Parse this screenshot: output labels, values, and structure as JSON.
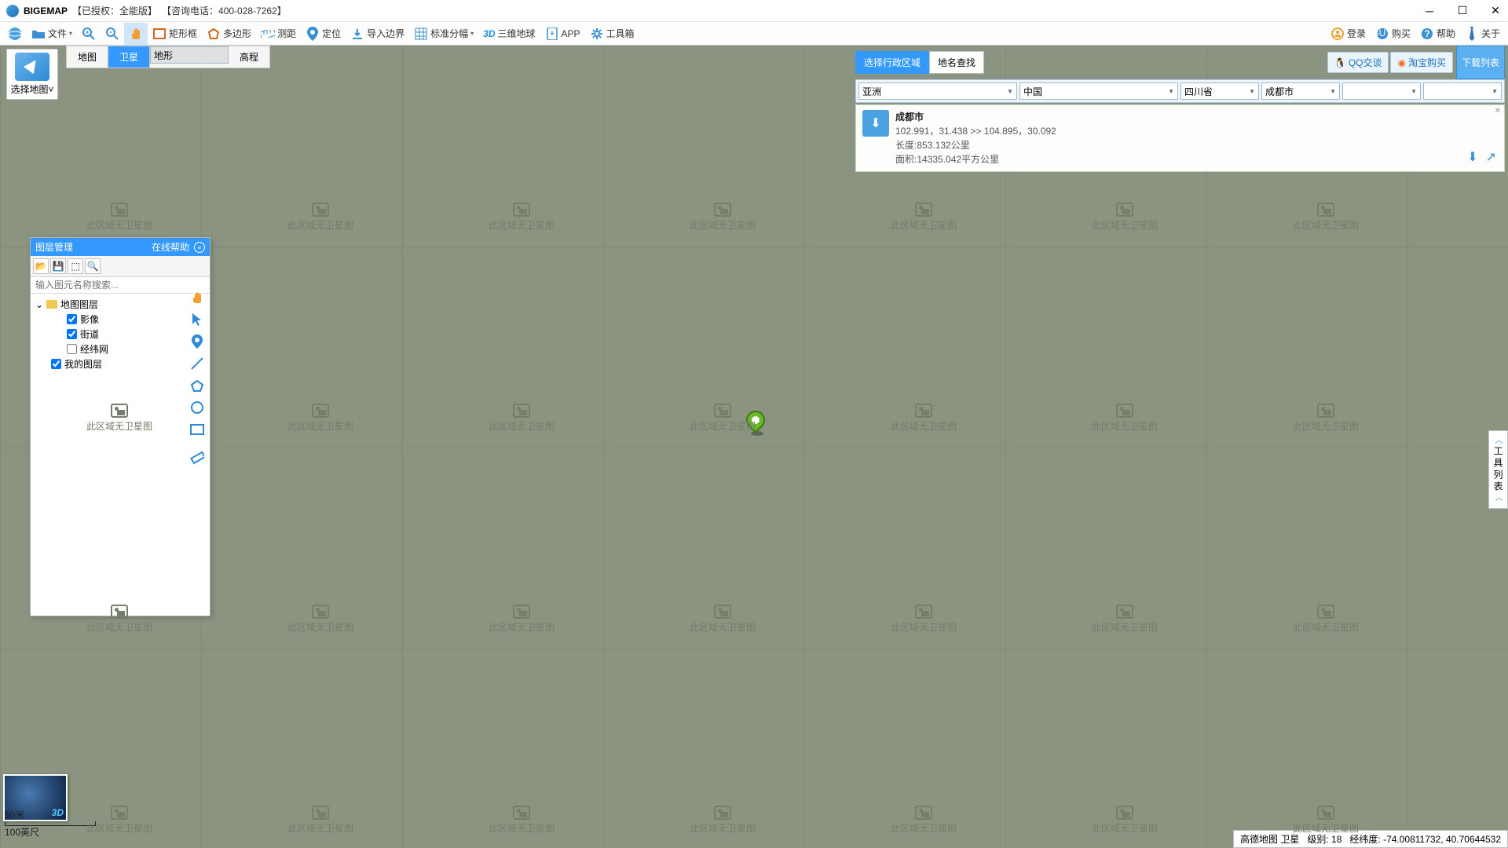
{
  "titlebar": {
    "app": "BIGEMAP",
    "auth": "【已授权：全能版】",
    "phone": "【咨询电话：400-028-7262】"
  },
  "toolbar": {
    "file": "文件",
    "rect": "矩形框",
    "poly": "多边形",
    "measure": "测距",
    "locate": "定位",
    "importb": "导入边界",
    "grid": "标准分幅",
    "globe": "三维地球",
    "app": "APP",
    "toolbox": "工具箱",
    "login": "登录",
    "buy": "购买",
    "help": "帮助",
    "about": "关于"
  },
  "viewtabs": {
    "map": "地图",
    "sat": "卫星",
    "terrain": "地形",
    "elev": "高程"
  },
  "selmap": "选择地图˅",
  "region": {
    "tab_area": "选择行政区域",
    "tab_name": "地名查找",
    "qq": "QQ交谈",
    "tb": "淘宝购买",
    "dl": "下载列表",
    "continent": "亚洲",
    "country": "中国",
    "prov": "四川省",
    "city": "成都市",
    "dist": "",
    "street": "",
    "result": {
      "title": "成都市",
      "coords": "102.991，31.438 >> 104.895，30.092",
      "len": "长度:853.132公里",
      "area": "面积:14335.042平方公里"
    }
  },
  "layer": {
    "title": "图层管理",
    "help": "在线帮助",
    "search_ph": "输入图元名称搜索...",
    "root": "地图图层",
    "img": "影像",
    "street": "街道",
    "grid": "经纬网",
    "my": "我的图层"
  },
  "watermark": "此区域无卫星图",
  "sidelabel": "工具列表",
  "preview3d": "3D",
  "scale": {
    "top": "50米",
    "bottom": "100英尺"
  },
  "status": {
    "provider": "高德地图 卫星",
    "level_lbl": "级别:",
    "level": "18",
    "coord_lbl": "经纬度:",
    "coord": "-74.00811732, 40.70644532"
  }
}
